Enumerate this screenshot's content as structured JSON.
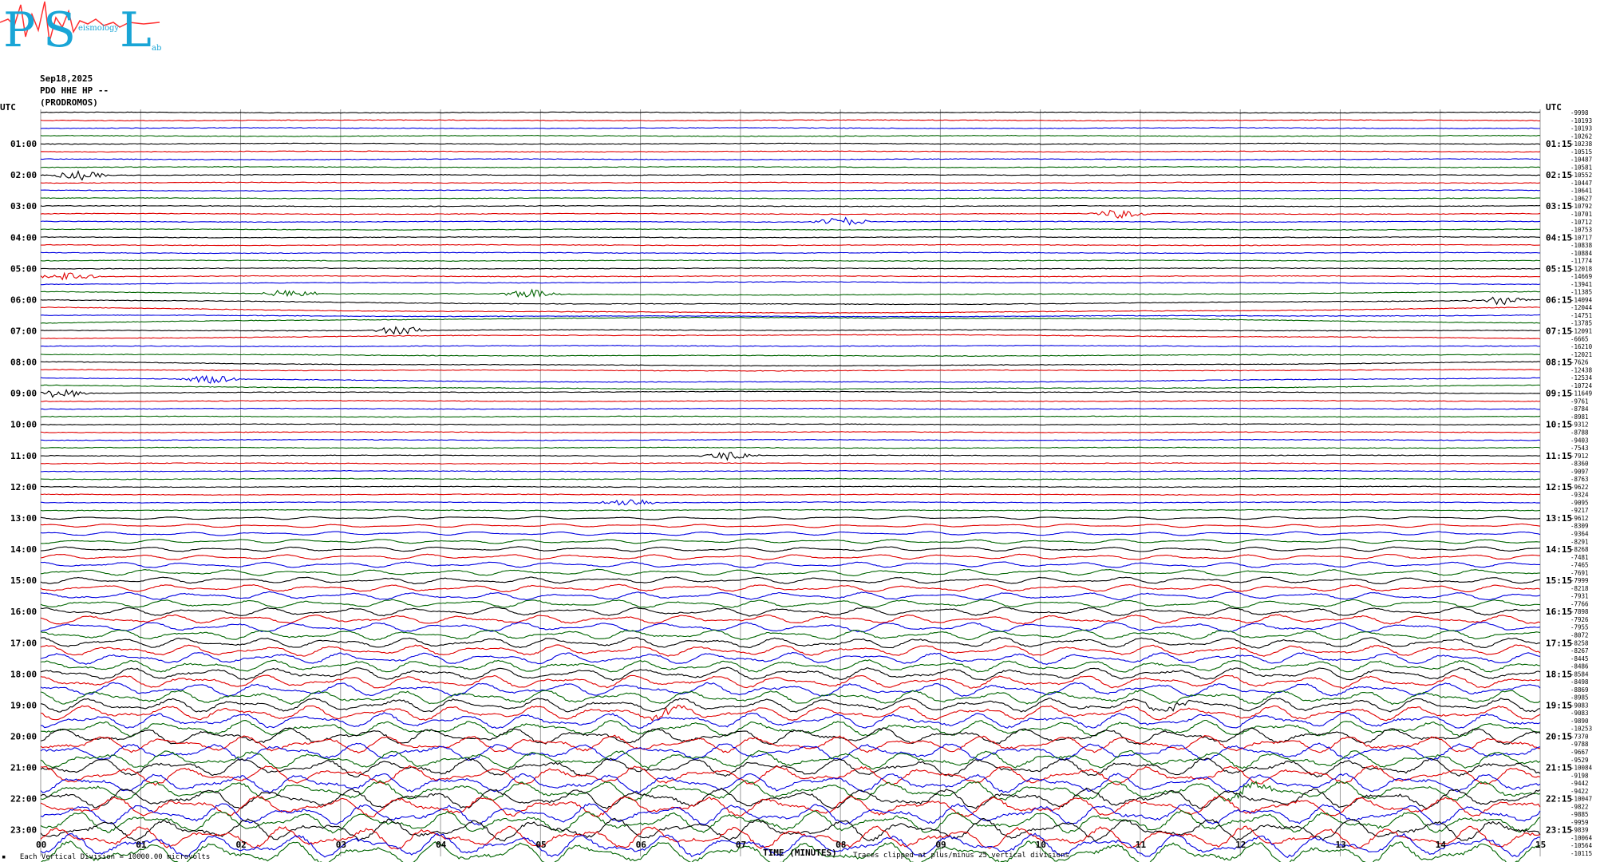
{
  "logo": {
    "letter_p": "P",
    "letter_s": "S",
    "letter_l": "L",
    "word_seismology": "eismology",
    "word_lab": "ab"
  },
  "header": {
    "date": "Sep18,2025",
    "station": "PDO HHE HP --",
    "site": "(PRODROMOS)"
  },
  "footer": {
    "vertical_division": "Each Vertical Division = 10000.00 microvolts",
    "clip_note": "Traces clipped at plus/minus 25 vertical divisions"
  },
  "colors": {
    "trace_cycle": [
      "#000000",
      "#e00000",
      "#0000e0",
      "#006400"
    ],
    "grid": "#9a9a9a"
  },
  "chart_data": {
    "type": "line",
    "title": "",
    "xlabel": "TIME (MINUTES)",
    "left_axis_label": "UTC",
    "right_axis_label": "UTC",
    "xlim": [
      0,
      15
    ],
    "x_ticks": [
      "00",
      "01",
      "02",
      "03",
      "04",
      "05",
      "06",
      "07",
      "08",
      "09",
      "10",
      "11",
      "12",
      "13",
      "14",
      "15"
    ],
    "left_hour_labels": [
      "01:00",
      "02:00",
      "03:00",
      "04:00",
      "05:00",
      "06:00",
      "07:00",
      "08:00",
      "09:00",
      "10:00",
      "11:00",
      "12:00",
      "13:00",
      "14:00",
      "15:00",
      "16:00",
      "17:00",
      "18:00",
      "19:00",
      "20:00",
      "21:00",
      "22:00",
      "23:00"
    ],
    "right_hour_labels": [
      "01:15",
      "02:15",
      "03:15",
      "04:15",
      "05:15",
      "06:15",
      "07:15",
      "08:15",
      "09:15",
      "10:15",
      "11:15",
      "12:15",
      "13:15",
      "14:15",
      "15:15",
      "16:15",
      "17:15",
      "18:15",
      "19:15",
      "20:15",
      "21:15",
      "22:15",
      "23:15"
    ],
    "trace_minutes": 15,
    "trace_count": 96,
    "trace_offsets": [
      "-9998",
      "-10193",
      "-10193",
      "-10262",
      "-10238",
      "-10515",
      "-10487",
      "-10581",
      "-10552",
      "-10447",
      "-10641",
      "-10627",
      "-10792",
      "-10701",
      "-10712",
      "-10753",
      "-10717",
      "-10838",
      "-10884",
      "-11774",
      "-12018",
      "-14669",
      "-13941",
      "-11385",
      "-14094",
      "-12044",
      "-14751",
      "-13785",
      "-12091",
      "-6665",
      "-16210",
      "-12021",
      "-7626",
      "-12438",
      "-12534",
      "-10724",
      "-11649",
      "-9761",
      "-8784",
      "-8981",
      "-9312",
      "-8788",
      "-9403",
      "-7543",
      "-7912",
      "-8360",
      "-9097",
      "-8763",
      "-9622",
      "-9324",
      "-9095",
      "-9217",
      "-9612",
      "-8309",
      "-9364",
      "-8291",
      "-8268",
      "-7481",
      "-7465",
      "-7691",
      "-7999",
      "-8218",
      "-7931",
      "-7766",
      "-7898",
      "-7926",
      "-7955",
      "-8072",
      "-8258",
      "-8267",
      "-8445",
      "-8486",
      "-8584",
      "-8498",
      "-8869",
      "-8985",
      "-9083",
      "-9083",
      "-9890",
      "-10253",
      "-7370",
      "-9788",
      "-9667",
      "-9529",
      "-10084",
      "-9198",
      "-9442",
      "-9422",
      "-10047",
      "-9822",
      "-9885",
      "-9959",
      "-9839",
      "-10064",
      "-10564",
      "-10115"
    ],
    "events": [
      {
        "trace": 8,
        "minute": 0.4
      },
      {
        "trace": 13,
        "minute": 10.8
      },
      {
        "trace": 14,
        "minute": 8.0
      },
      {
        "trace": 21,
        "minute": 0.3
      },
      {
        "trace": 23,
        "minute": 2.5
      },
      {
        "trace": 23,
        "minute": 4.9
      },
      {
        "trace": 24,
        "minute": 14.6
      },
      {
        "trace": 28,
        "minute": 3.6
      },
      {
        "trace": 34,
        "minute": 1.7
      },
      {
        "trace": 36,
        "minute": 0.2
      },
      {
        "trace": 44,
        "minute": 6.9
      },
      {
        "trace": 50,
        "minute": 5.9
      },
      {
        "trace": 77,
        "minute": 6.3
      },
      {
        "trace": 76,
        "minute": 11.3
      },
      {
        "trace": 87,
        "minute": 12.1
      }
    ],
    "grid": true
  }
}
